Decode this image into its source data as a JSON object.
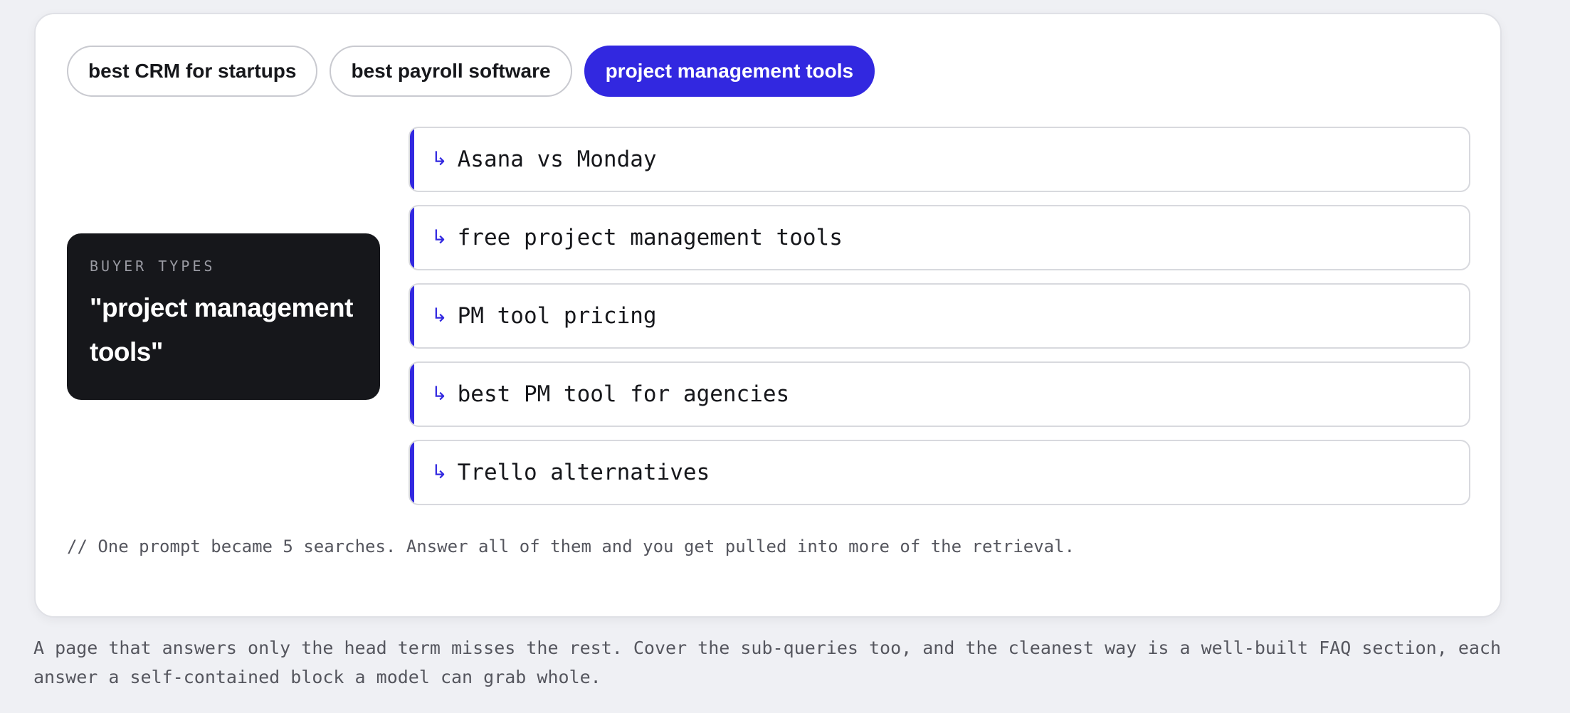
{
  "chips": [
    {
      "label": "best CRM for startups",
      "active": false
    },
    {
      "label": "best payroll software",
      "active": false
    },
    {
      "label": "project management tools",
      "active": true
    }
  ],
  "buyer": {
    "label": "BUYER TYPES",
    "query": "\"project management tools\""
  },
  "subqueries": {
    "arrow_glyph": "↳",
    "items": [
      "Asana vs Monday",
      "free project management tools",
      "PM tool pricing",
      "best PM tool for agencies",
      "Trello alternatives"
    ]
  },
  "footnote": "// One prompt became 5 searches. Answer all of them and you get pulled into more of the retrieval.",
  "caption": "A page that answers only the head term misses the rest. Cover the sub-queries too, and the cleanest way is a well-built FAQ section, each answer a self-contained block a model can grab whole.",
  "colors": {
    "accent": "#3228e0",
    "dark_panel": "#16171b",
    "background": "#eff0f4"
  }
}
